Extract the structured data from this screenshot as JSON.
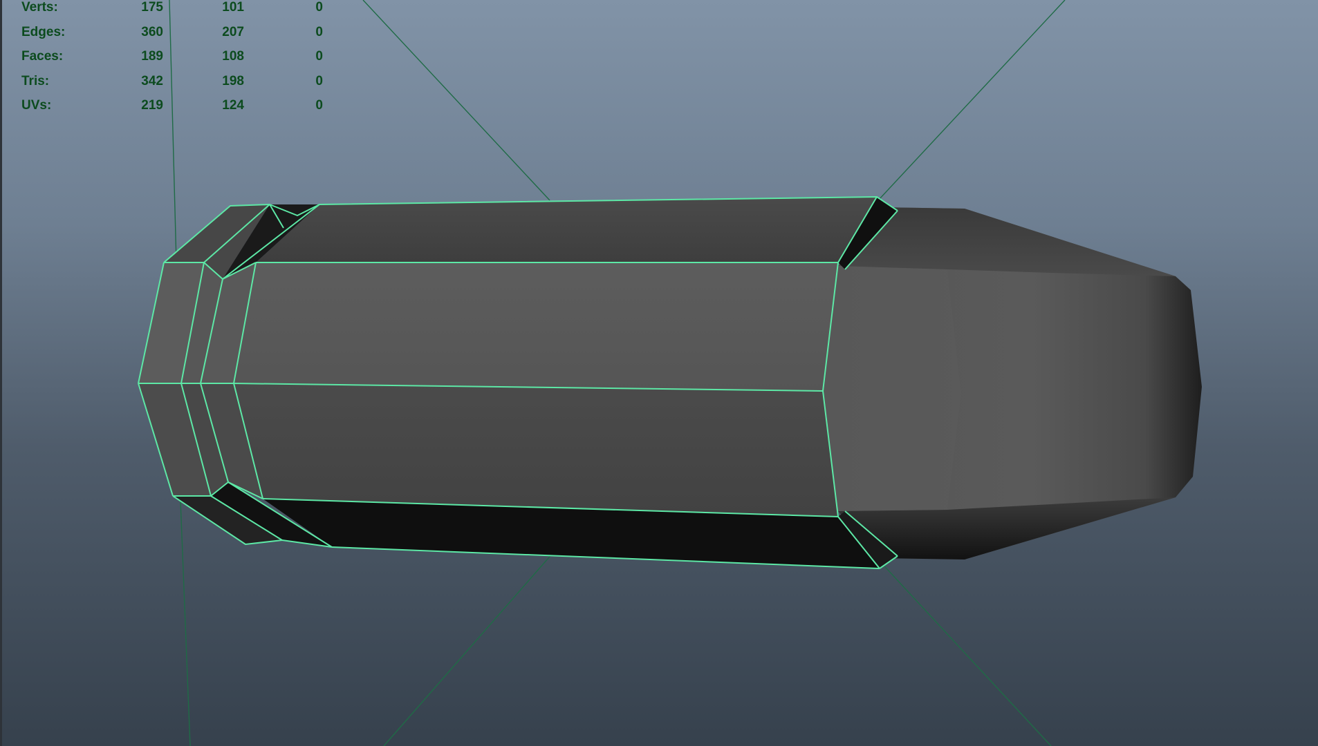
{
  "heads_up_display": {
    "rows": [
      {
        "label": "Verts:",
        "values": [
          "175",
          "101",
          "0"
        ]
      },
      {
        "label": "Edges:",
        "values": [
          "360",
          "207",
          "0"
        ]
      },
      {
        "label": "Faces:",
        "values": [
          "189",
          "108",
          "0"
        ]
      },
      {
        "label": "Tris:",
        "values": [
          "342",
          "198",
          "0"
        ]
      },
      {
        "label": "UVs:",
        "values": [
          "219",
          "124",
          "0"
        ]
      }
    ]
  },
  "colors": {
    "hud_text": "#0c4b1e",
    "wireframe_highlight": "#5de8a6",
    "manipulator_lines": "#1f6b46",
    "background_top": "#8193a7",
    "background_bottom": "#36414d"
  }
}
